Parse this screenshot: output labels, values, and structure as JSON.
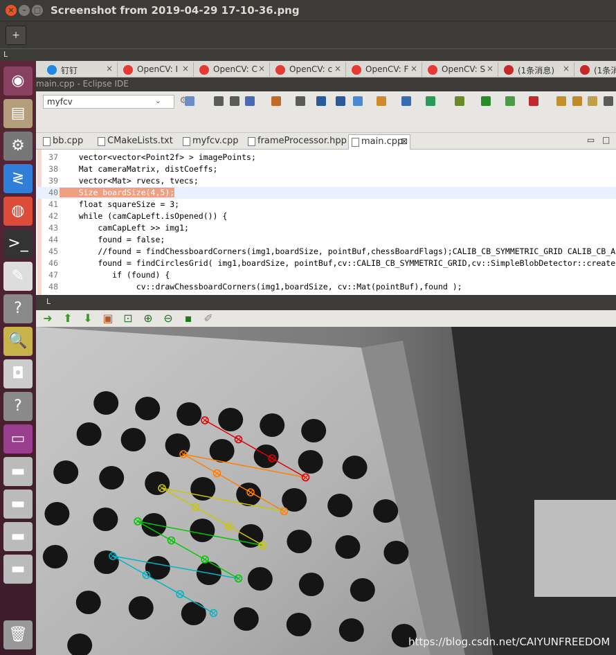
{
  "viewer": {
    "title": "Screenshot from 2019-04-29 17-10-36.png",
    "toolbar_button": "+",
    "inner_label": "L"
  },
  "launcher": {
    "items": [
      {
        "name": "ubuntu-dash-icon",
        "glyph": "◉",
        "color": "#8a4060"
      },
      {
        "name": "file-manager-icon",
        "glyph": "▤",
        "color": "#b39d7a"
      },
      {
        "name": "system-settings-icon",
        "glyph": "⚙",
        "color": "#777777"
      },
      {
        "name": "visual-studio-code-icon",
        "glyph": "≷",
        "color": "#2f7ed8"
      },
      {
        "name": "chrome-icon",
        "glyph": "◍",
        "color": "#dd4b39"
      },
      {
        "name": "terminal-icon",
        "glyph": ">_",
        "color": "#333333"
      },
      {
        "name": "text-editor-icon",
        "glyph": "✎",
        "color": "#dddddd"
      },
      {
        "name": "unknown-app-icon",
        "glyph": "?",
        "color": "#8a8a8a"
      },
      {
        "name": "image-viewer-icon",
        "glyph": "🔍",
        "color": "#c8b24a"
      },
      {
        "name": "camera-icon",
        "glyph": "◘",
        "color": "#cccccc"
      },
      {
        "name": "unknown-app-2-icon",
        "glyph": "?",
        "color": "#8a8a8a"
      },
      {
        "name": "window-app-icon",
        "glyph": "▭",
        "color": "#9c3e90"
      },
      {
        "name": "drive-1-icon",
        "glyph": "▬",
        "color": "#bbbbbb"
      },
      {
        "name": "drive-2-icon",
        "glyph": "▬",
        "color": "#bbbbbb"
      },
      {
        "name": "drive-3-icon",
        "glyph": "▬",
        "color": "#bbbbbb"
      },
      {
        "name": "drive-4-icon",
        "glyph": "▬",
        "color": "#bbbbbb"
      },
      {
        "name": "trash-icon",
        "glyph": "🗑",
        "color": "#999999"
      }
    ]
  },
  "browser": {
    "tabs": [
      {
        "label": "钉钉",
        "icon": "dingtalk-icon",
        "color": "#1e88e5"
      },
      {
        "label": "OpenCV: I",
        "icon": "opencv-icon",
        "color": "#e53935"
      },
      {
        "label": "OpenCV: C",
        "icon": "opencv-icon",
        "color": "#e53935"
      },
      {
        "label": "OpenCV: c",
        "icon": "opencv-icon",
        "color": "#e53935"
      },
      {
        "label": "OpenCV: F",
        "icon": "opencv-icon",
        "color": "#e53935"
      },
      {
        "label": "OpenCV: S",
        "icon": "opencv-icon",
        "color": "#e53935"
      },
      {
        "label": "(1条消息)",
        "icon": "csdn-icon",
        "color": "#c62828"
      },
      {
        "label": "(1条消",
        "icon": "csdn-icon",
        "color": "#c62828"
      }
    ]
  },
  "eclipse": {
    "title": "main.cpp - Eclipse IDE",
    "project": "myfcv",
    "tabs": [
      "bb.cpp",
      "CMakeLists.txt",
      "myfcv.cpp",
      "frameProcessor.hpp",
      "main.cpp"
    ],
    "active_tab_close": "⊠",
    "minimize": "▭",
    "maximize": "□",
    "code": [
      {
        "n": "37",
        "t": "    vector<vector<Point2f> > imagePoints;"
      },
      {
        "n": "38",
        "t": "    Mat cameraMatrix, distCoeffs;"
      },
      {
        "n": "39",
        "t": "    vector<Mat> rvecs, tvecs;"
      },
      {
        "n": "40",
        "t": "    Size boardSize(4,5);"
      },
      {
        "n": "41",
        "t": "    float squareSize = 3;"
      },
      {
        "n": "42",
        "t": "    while (camCapLeft.isOpened()) {"
      },
      {
        "n": "43",
        "t": "        camCapLeft >> img1;"
      },
      {
        "n": "44",
        "t": "        found = false;"
      },
      {
        "n": "45",
        "t": "        //found = findChessboardCorners(img1,boardSize, pointBuf,chessBoardFlags);CALIB_CB_SYMMETRIC_GRID CALIB_CB_ASYMMET"
      },
      {
        "n": "46",
        "t": "        found = findCirclesGrid( img1,boardSize, pointBuf,cv::CALIB_CB_SYMMETRIC_GRID,cv::SimpleBlobDetector::create());"
      },
      {
        "n": "47",
        "t": "           if (found) {"
      },
      {
        "n": "48",
        "t": "                cv::drawChessboardCorners(img1,boardSize, cv::Mat(pointBuf),found );"
      }
    ]
  },
  "viewer2": {
    "label": "L",
    "toolbar": [
      {
        "name": "arrow-right-icon",
        "glyph": "➜",
        "color": "#3a9a2a"
      },
      {
        "name": "arrow-up-icon",
        "glyph": "⬆",
        "color": "#3a9a2a"
      },
      {
        "name": "arrow-down-icon",
        "glyph": "⬇",
        "color": "#3a9a2a"
      },
      {
        "name": "image-icon",
        "glyph": "▣",
        "color": "#b85a2a"
      },
      {
        "name": "zoom-fit-icon",
        "glyph": "⊡",
        "color": "#3a7a3a"
      },
      {
        "name": "zoom-in-icon",
        "glyph": "⊕",
        "color": "#2a6a2a"
      },
      {
        "name": "zoom-out-icon",
        "glyph": "⊖",
        "color": "#2a6a2a"
      },
      {
        "name": "save-icon",
        "glyph": "▪",
        "color": "#1f7a1f"
      },
      {
        "name": "brush-icon",
        "glyph": "✐",
        "color": "#888888"
      }
    ]
  },
  "grid_rows": [
    {
      "color": "#e00000"
    },
    {
      "color": "#ff7f00"
    },
    {
      "color": "#c8c800"
    },
    {
      "color": "#00c800"
    },
    {
      "color": "#00b4c8"
    }
  ],
  "watermark": "https://blog.csdn.net/CAIYUNFREEDOM"
}
